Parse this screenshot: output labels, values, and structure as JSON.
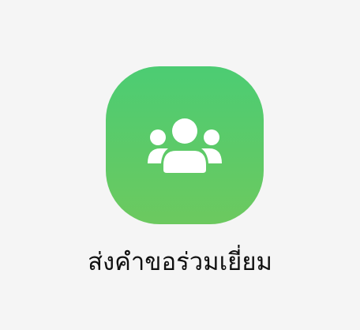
{
  "action": {
    "label": "ส่งคำขอร่วมเยี่ยม",
    "icon": "group-users-icon",
    "gradient_top": "#4ccc73",
    "gradient_bottom": "#6cc95f"
  }
}
